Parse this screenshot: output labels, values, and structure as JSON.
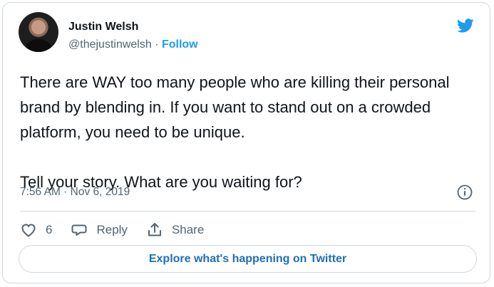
{
  "tweet": {
    "author_name": "Justin Welsh",
    "handle": "@thejustinwelsh",
    "separator": " · ",
    "follow_label": "Follow",
    "text": "There are WAY too many people who are killing their personal brand by blending in. If you want to stand out on a crowded platform, you need to be unique.\n\nTell your story. What are you waiting for?",
    "timestamp": "7:56 AM · Nov 6, 2019"
  },
  "actions": {
    "like_count": "6",
    "reply_label": "Reply",
    "share_label": "Share"
  },
  "explore_label": "Explore what's happening on Twitter",
  "colors": {
    "accent": "#1d9bf0",
    "text": "#0f1419",
    "secondary": "#536471",
    "border": "#cfd9de"
  }
}
